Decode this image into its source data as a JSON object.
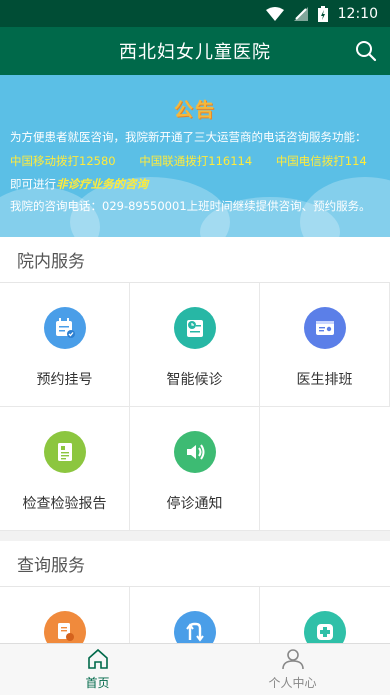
{
  "status": {
    "time": "12:10"
  },
  "header": {
    "title": "西北妇女儿童医院"
  },
  "notice": {
    "title": "公告",
    "line1": "为方便患者就医咨询，我院新开通了三大运营商的电话咨询服务功能：",
    "carriers": [
      "中国移动拨打12580",
      "中国联通拨打116114",
      "中国电信拨打114"
    ],
    "line3_prefix": "即可进行",
    "line3_em": "非诊疗业务的咨询",
    "line4": "我院的咨询电话：029-89550001上班时间继续提供咨询、预约服务。"
  },
  "sections": {
    "inhouse": {
      "title": "院内服务",
      "items": [
        {
          "label": "预约挂号",
          "icon": "calendar-icon",
          "color": "#4a9ee8"
        },
        {
          "label": "智能候诊",
          "icon": "clock-clipboard-icon",
          "color": "#27b7a5"
        },
        {
          "label": "医生排班",
          "icon": "id-card-icon",
          "color": "#5b7fe8"
        },
        {
          "label": "检查检验报告",
          "icon": "report-icon",
          "color": "#8cc63f"
        },
        {
          "label": "停诊通知",
          "icon": "speaker-icon",
          "color": "#3dbb73"
        }
      ]
    },
    "query": {
      "title": "查询服务",
      "items": [
        {
          "icon": "document-search-icon",
          "color": "#f08a3c"
        },
        {
          "icon": "transfer-icon",
          "color": "#4a9ee8"
        },
        {
          "icon": "medical-cross-icon",
          "color": "#2fc0a8"
        }
      ]
    }
  },
  "tabs": [
    {
      "label": "首页",
      "icon": "home-icon",
      "active": true
    },
    {
      "label": "个人中心",
      "icon": "person-icon",
      "active": false
    }
  ],
  "colors": {
    "primary": "#00694a",
    "statusbar": "#004d35",
    "notice_bg": "#5bbfe6"
  }
}
